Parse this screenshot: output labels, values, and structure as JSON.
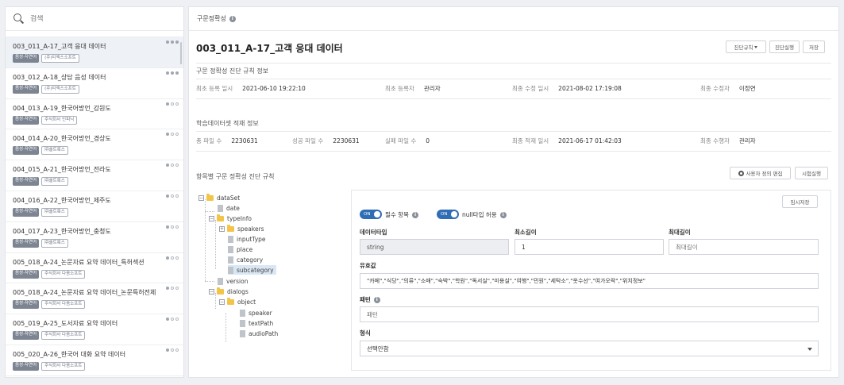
{
  "sidebar": {
    "search_placeholder": "검색",
    "items": [
      {
        "title": "003_011_A-17_고객 응대 데이터",
        "tag1": "음성·자연어",
        "tag2": "(주)티엑스소프트",
        "selected": true
      },
      {
        "title": "003_012_A-18_상담 음성 데이터",
        "tag1": "음성·자연어",
        "tag2": "(주)티엑스소프트"
      },
      {
        "title": "004_013_A-19_한국어방언_강원도",
        "tag1": "음성·자연어",
        "tag2": "주식회사 인피닉"
      },
      {
        "title": "004_014_A-20_한국어방언_경상도",
        "tag1": "음성·자연어",
        "tag2": "㈜솔트룩스"
      },
      {
        "title": "004_015_A-21_한국어방언_전라도",
        "tag1": "음성·자연어",
        "tag2": "㈜솔트룩스"
      },
      {
        "title": "004_016_A-22_한국어방언_제주도",
        "tag1": "음성·자연어",
        "tag2": "㈜솔트룩스"
      },
      {
        "title": "004_017_A-23_한국어방언_충청도",
        "tag1": "음성·자연어",
        "tag2": "㈜솔트룩스"
      },
      {
        "title": "005_018_A-24_논문자료 요약 데이터_특허섹션",
        "tag1": "음성·자연어",
        "tag2": "주식회사 다음소프트"
      },
      {
        "title": "005_018_A-24_논문자료 요약 데이터_논문특허전체",
        "tag1": "음성·자연어",
        "tag2": "주식회사 다음소프트"
      },
      {
        "title": "005_019_A-25_도서자료 요약 데이터",
        "tag1": "음성·자연어",
        "tag2": "주식회사 다음소프트"
      },
      {
        "title": "005_020_A-26_한국어 대화 요약 데이터",
        "tag1": "음성·자연어",
        "tag2": "주식회사 다음소프트"
      }
    ]
  },
  "header": {
    "title": "구문정확성"
  },
  "page": {
    "title": "003_011_A-17_고객 응대 데이터",
    "buttons": {
      "diagnose_rule": "진단규칙",
      "run_diagnosis": "진단실행",
      "save": "저장"
    }
  },
  "rule_info": {
    "title": "구문 정확성 진단 규칙 정보",
    "first_reg_date_label": "최초 등록 일시",
    "first_reg_date": "2021-06-10 19:22:10",
    "first_registrant_label": "최초 등록자",
    "first_registrant": "관리자",
    "last_mod_date_label": "최종 수정 일시",
    "last_mod_date": "2021-08-02 17:19:08",
    "last_modifier_label": "최종 수정자",
    "last_modifier": "이정연"
  },
  "load_info": {
    "title": "학습데이터셋 적재 정보",
    "total_files_label": "총 파일 수",
    "total_files": "2230631",
    "success_files_label": "성공 파일 수",
    "success_files": "2230631",
    "failed_files_label": "실패 파일 수",
    "failed_files": "0",
    "last_load_date_label": "최종 적재 일시",
    "last_load_date": "2021-06-17 01:42:03",
    "last_performer_label": "최종 수행자",
    "last_performer": "관리자"
  },
  "item_rules": {
    "title": "항목별 구문 정확성 진단 규칙",
    "custom_edit_button": "사용자 정의 편집",
    "test_run_button": "시험실행"
  },
  "tree": {
    "dataSet": "dataSet",
    "date": "date",
    "typeInfo": "typeInfo",
    "speakers": "speakers",
    "inputType": "inputType",
    "place": "place",
    "category": "category",
    "subcategory": "subcategory",
    "version": "version",
    "dialogs": "dialogs",
    "object": "object",
    "speaker": "speaker",
    "textPath": "textPath",
    "audioPath": "audioPath"
  },
  "detail": {
    "temp_save_button": "임시저장",
    "required_toggle": "ON",
    "required_label": "필수 항목",
    "null_toggle": "ON",
    "null_label": "null타입 허용",
    "datatype_label": "데이터타입",
    "datatype_value": "string",
    "min_len_label": "최소길이",
    "min_len_value": "1",
    "max_len_label": "최대길이",
    "max_len_placeholder": "최대길이",
    "valid_label": "유효값",
    "valid_value": "\"카페\",\"식당\",\"의류\",\"소매\",\"숙박\",\"학원\",\"독서실\",\"미용실\",\"여행\",\"민원\",\"세탁소\",\"옷수선\",\"여가오락\",\"위치정보\"",
    "pattern_label": "패턴",
    "pattern_placeholder": "패턴",
    "format_label": "형식",
    "format_value": "선택안함"
  },
  "colors": {
    "accent": "#2f6db5",
    "folder": "#f3c44a",
    "selected_row": "#eef1f6"
  }
}
